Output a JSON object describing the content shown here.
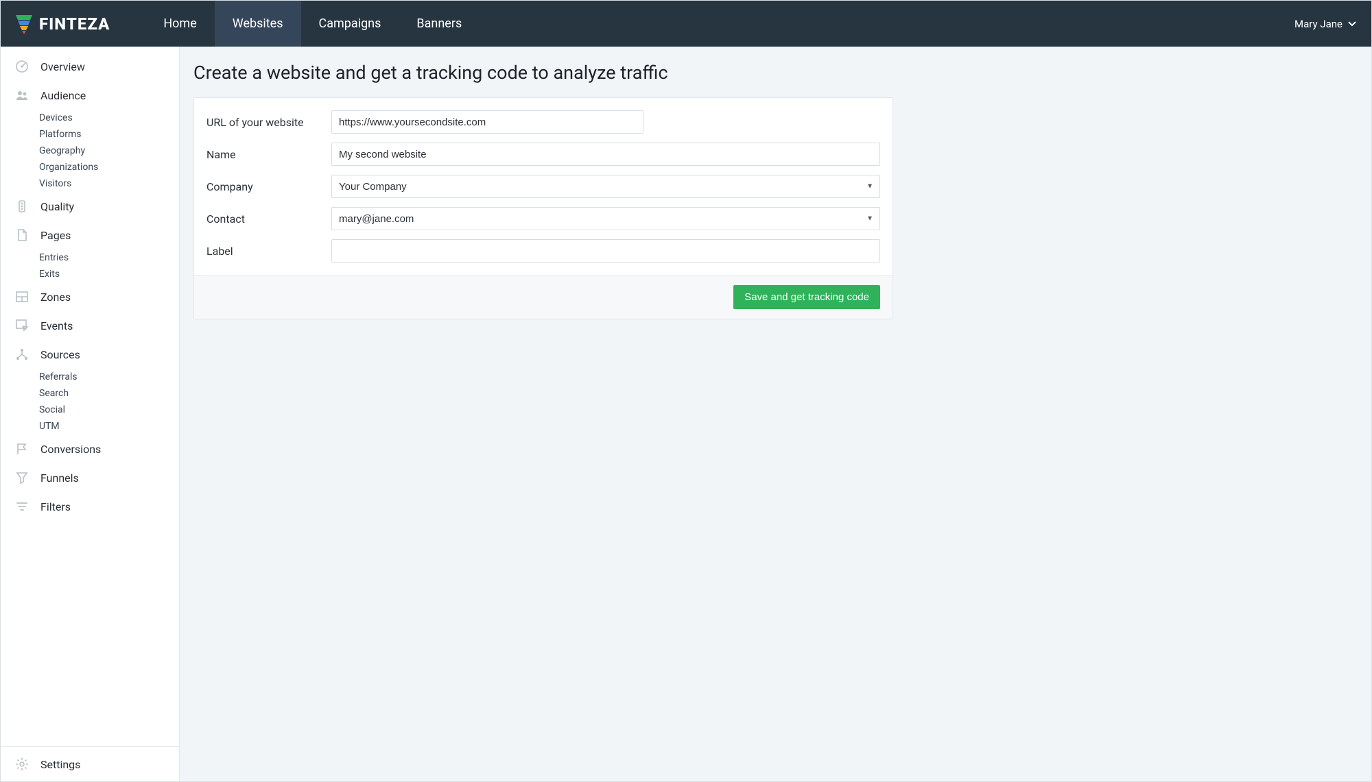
{
  "brand": {
    "name": "FINTEZA"
  },
  "topnav": {
    "items": [
      {
        "label": "Home"
      },
      {
        "label": "Websites"
      },
      {
        "label": "Campaigns"
      },
      {
        "label": "Banners"
      }
    ]
  },
  "user": {
    "display_name": "Mary Jane"
  },
  "sidebar": {
    "overview": "Overview",
    "audience": {
      "label": "Audience",
      "items": [
        "Devices",
        "Platforms",
        "Geography",
        "Organizations",
        "Visitors"
      ]
    },
    "quality": "Quality",
    "pages": {
      "label": "Pages",
      "items": [
        "Entries",
        "Exits"
      ]
    },
    "zones": "Zones",
    "events": "Events",
    "sources": {
      "label": "Sources",
      "items": [
        "Referrals",
        "Search",
        "Social",
        "UTM"
      ]
    },
    "conversions": "Conversions",
    "funnels": "Funnels",
    "filters": "Filters",
    "settings": "Settings"
  },
  "page": {
    "title": "Create a website and get a tracking code to analyze traffic"
  },
  "form": {
    "url": {
      "label": "URL of your website",
      "value": "https://www.yoursecondsite.com"
    },
    "name": {
      "label": "Name",
      "value": "My second website"
    },
    "company": {
      "label": "Company",
      "value": "Your Company"
    },
    "contact": {
      "label": "Contact",
      "value": "mary@jane.com"
    },
    "label_field": {
      "label": "Label",
      "value": ""
    },
    "submit": "Save and get tracking code"
  }
}
